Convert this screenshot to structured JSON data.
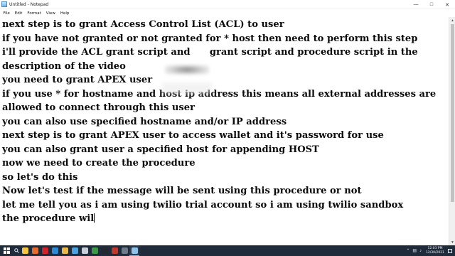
{
  "window": {
    "title": "Untitled - Notepad",
    "controls": [
      "—",
      "□",
      "✕"
    ]
  },
  "menu": [
    "File",
    "Edit",
    "Format",
    "View",
    "Help"
  ],
  "editor": {
    "lines": [
      "next step is to grant Access Control List (ACL) to user",
      "if you have not granted or not granted for * host then need to perform this step",
      "i'll provide the ACL grant script and      grant script and procedure script in the",
      "description of the video",
      "you need to grant APEX user",
      "if you use * for hostname and host ip address this means all external addresses are",
      "allowed to connect through this user",
      "you can also use specified hostname and/or IP address",
      "next step is to grant APEX user to access wallet and it's password for use",
      "you can also grant user a specified host for appending HOST",
      "now we need to create the procedure",
      "so let's do this",
      "Now let's test if the message will be sent using this procedure or not",
      "let me tell you as i am using twilio trial account so i am using twilio sandbox",
      "the procedure wil"
    ]
  },
  "taskbar": {
    "icons": [
      {
        "name": "file-explorer-icon",
        "color": "#f4c542"
      },
      {
        "name": "firefox-icon",
        "color": "#e66a2c"
      },
      {
        "name": "opera-icon",
        "color": "#d1232a"
      },
      {
        "name": "edge-icon",
        "color": "#2d8bd6"
      },
      {
        "name": "folder-icon",
        "color": "#e8b84a"
      },
      {
        "name": "photos-icon",
        "color": "#4aa3df"
      },
      {
        "name": "snipping-icon",
        "color": "#c8cfd8"
      },
      {
        "name": "chrome-icon",
        "color": "#3b9a45"
      },
      {
        "name": "terminal-icon",
        "color": "#23272e"
      },
      {
        "name": "database-icon",
        "color": "#c0392b"
      },
      {
        "name": "app-icon",
        "color": "#6c7a89"
      },
      {
        "name": "notepad-icon",
        "color": "#8ec3ea"
      }
    ],
    "time": "12:03 PM",
    "date": "12/30/2021"
  }
}
